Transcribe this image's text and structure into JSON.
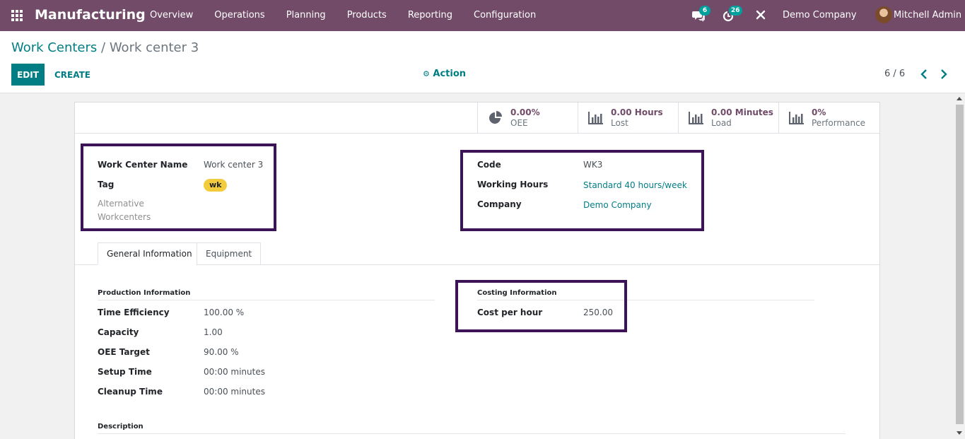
{
  "navbar": {
    "app_name": "Manufacturing",
    "menu": [
      "Overview",
      "Operations",
      "Planning",
      "Products",
      "Reporting",
      "Configuration"
    ],
    "messages_count": "6",
    "activities_count": "26",
    "company": "Demo Company",
    "user": "Mitchell Admin"
  },
  "breadcrumb": {
    "parent": "Work Centers",
    "separator": "/",
    "current": "Work center 3"
  },
  "buttons": {
    "edit": "EDIT",
    "create": "CREATE",
    "action": "Action"
  },
  "pager": {
    "text": "6 / 6"
  },
  "stats": [
    {
      "value": "0.00%",
      "label": "OEE",
      "icon": "pie-chart-icon"
    },
    {
      "value": "0.00 Hours",
      "label": "Lost",
      "icon": "bar-chart-icon"
    },
    {
      "value": "0.00 Minutes",
      "label": "Load",
      "icon": "bar-chart-icon"
    },
    {
      "value": "0%",
      "label": "Performance",
      "icon": "bar-chart-icon"
    }
  ],
  "form": {
    "name_label": "Work Center Name",
    "name_value": "Work center 3",
    "tag_label": "Tag",
    "tag_value": "wk",
    "alternative_label_1": "Alternative",
    "alternative_label_2": "Workcenters",
    "code_label": "Code",
    "code_value": "WK3",
    "working_hours_label": "Working Hours",
    "working_hours_value": "Standard 40 hours/week",
    "company_label": "Company",
    "company_value": "Demo Company"
  },
  "tabs": [
    "General Information",
    "Equipment"
  ],
  "production": {
    "title": "Production Information",
    "fields": [
      {
        "label": "Time Efficiency",
        "value": "100.00  %"
      },
      {
        "label": "Capacity",
        "value": "1.00"
      },
      {
        "label": "OEE Target",
        "value": "90.00  %"
      },
      {
        "label": "Setup Time",
        "value": "00:00 minutes"
      },
      {
        "label": "Cleanup Time",
        "value": "00:00 minutes"
      }
    ]
  },
  "costing": {
    "title": "Costing Information",
    "cost_label": "Cost per hour",
    "cost_value": "250.00"
  },
  "description": {
    "title": "Description"
  },
  "colors": {
    "navbar": "#714b67",
    "primary": "#017e84",
    "highlight": "#3d1357",
    "tag": "#f3cc3e",
    "badge": "#00a09d"
  }
}
